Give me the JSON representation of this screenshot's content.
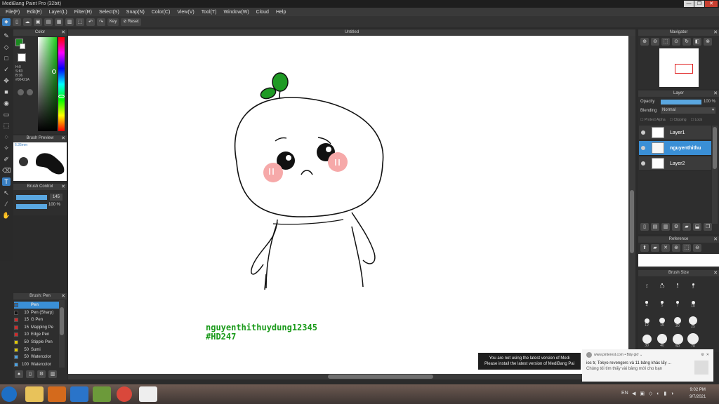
{
  "window": {
    "title": "MediBang Paint Pro (32bit)",
    "buttons": [
      "—",
      "❐",
      "✕"
    ]
  },
  "menu": [
    "File(F)",
    "Edit(E)",
    "Layer(L)",
    "Filter(R)",
    "Select(S)",
    "Snap(N)",
    "Color(C)",
    "View(V)",
    "Tool(T)",
    "Window(W)",
    "Cloud",
    "Help"
  ],
  "toolbar": {
    "key_label": "Key",
    "reset_label": "Reset"
  },
  "color_panel": {
    "title": "Color",
    "values": [
      "H:0",
      "S:83",
      "B:36",
      "#00421A"
    ],
    "primary": "#1b8a20",
    "secondary": "#ffffff"
  },
  "brush_preview": {
    "title": "Brush Preview",
    "size_label": "6.35mm"
  },
  "brush_control": {
    "title": "Brush Control",
    "size_value": "145",
    "opacity_value": "100 %"
  },
  "brush_list": {
    "title": "Brush: Pen",
    "items": [
      {
        "size": "",
        "name": "Pen",
        "color": "#1f6fb8",
        "selected": true
      },
      {
        "size": "10",
        "name": "Pen (Sharp)",
        "color": "#111111"
      },
      {
        "size": "15",
        "name": "G Pen",
        "color": "#d02a2a"
      },
      {
        "size": "15",
        "name": "Mapping Pe",
        "color": "#d02a2a"
      },
      {
        "size": "10",
        "name": "Edge Pen",
        "color": "#d02a2a"
      },
      {
        "size": "50",
        "name": "Stipple Pen",
        "color": "#e0c800"
      },
      {
        "size": "50",
        "name": "Sumi",
        "color": "#e0c800"
      },
      {
        "size": "50",
        "name": "Watercolor",
        "color": "#4aa0e0"
      },
      {
        "size": "100",
        "name": "Watercolor",
        "color": "#4aa0e0"
      }
    ]
  },
  "canvas": {
    "tab_title": "Untitled",
    "signature_line1": "nguyenthithuydung12345",
    "signature_line2": "#HD247",
    "signature_color": "#1a9a1a"
  },
  "navigator": {
    "title": "Navigator"
  },
  "layer_panel": {
    "title": "Layer",
    "opacity_label": "Opacity",
    "opacity_value": "100 %",
    "blending_label": "Blending",
    "blending_value": "Normal",
    "protect_alpha": "Protect Alpha",
    "clipping": "Clipping",
    "lock": "Lock",
    "layers": [
      {
        "name": "Layer1",
        "selected": false
      },
      {
        "name": "nguyenthithu",
        "selected": true
      },
      {
        "name": "Layer2",
        "selected": false
      }
    ]
  },
  "reference": {
    "title": "Reference"
  },
  "brush_size": {
    "title": "Brush Size",
    "rows": [
      [
        "1",
        "1.5",
        "2",
        "3"
      ],
      [
        "4",
        "5",
        "7",
        "10"
      ],
      [
        "12",
        "15",
        "20",
        "25"
      ],
      [
        "30",
        "40",
        "50",
        "70"
      ]
    ]
  },
  "notice": {
    "line1": "You are not using the latest version of Medi",
    "line2": "Please install the latest version of MediBang Pai"
  },
  "toast": {
    "source": "www.pinterest.com • Bây giờ ⌄",
    "line1": "ios tr, Tokyo revengers và 11 bảng khác lấy ...",
    "line2": "Chúng tôi tìm thấy vài bảng mới cho bạn"
  },
  "taskbar": {
    "lang": "EN",
    "time": "9:02 PM",
    "date": "9/7/2021"
  }
}
